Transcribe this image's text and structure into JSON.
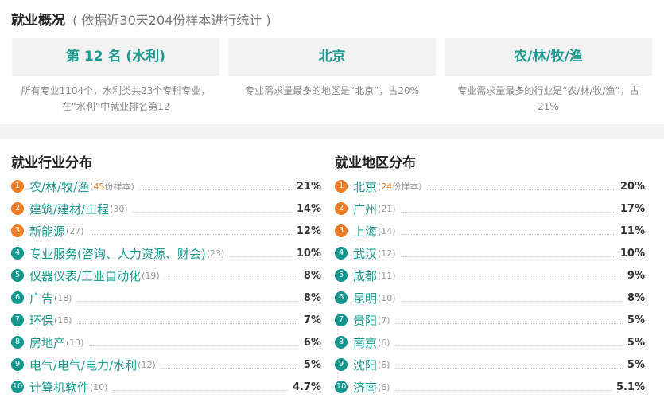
{
  "overview": {
    "title": "就业概况",
    "subtitle": "( 依据近30天204份样本进行统计 )",
    "cards": [
      {
        "label": "第 12 名 (水利)",
        "desc": "所有专业1104个，水利类共23个专科专业，在“水利”中就业排名第12"
      },
      {
        "label": "北京",
        "desc": "专业需求量最多的地区是“北京”，占20%"
      },
      {
        "label": "农/林/牧/渔",
        "desc": "专业需求量最多的行业是“农/林/牧/渔”，占21%"
      }
    ]
  },
  "industry": {
    "title": "就业行业分布",
    "items": [
      {
        "rank": "1",
        "name": "农/林/牧/渔",
        "count_pre": "(",
        "count_num": "45",
        "count_post": "份样本)",
        "pct": "21%"
      },
      {
        "rank": "2",
        "name": "建筑/建材/工程",
        "count_pre": "(30)",
        "count_num": "",
        "count_post": "",
        "pct": "14%"
      },
      {
        "rank": "3",
        "name": "新能源",
        "count_pre": "(27)",
        "count_num": "",
        "count_post": "",
        "pct": "12%"
      },
      {
        "rank": "4",
        "name": "专业服务(咨询、人力资源、财会)",
        "count_pre": "(23)",
        "count_num": "",
        "count_post": "",
        "pct": "10%"
      },
      {
        "rank": "5",
        "name": "仪器仪表/工业自动化",
        "count_pre": "(19)",
        "count_num": "",
        "count_post": "",
        "pct": "8%"
      },
      {
        "rank": "6",
        "name": "广告",
        "count_pre": "(18)",
        "count_num": "",
        "count_post": "",
        "pct": "8%"
      },
      {
        "rank": "7",
        "name": "环保",
        "count_pre": "(16)",
        "count_num": "",
        "count_post": "",
        "pct": "7%"
      },
      {
        "rank": "8",
        "name": "房地产",
        "count_pre": "(13)",
        "count_num": "",
        "count_post": "",
        "pct": "6%"
      },
      {
        "rank": "9",
        "name": "电气/电气/电力/水利",
        "count_pre": "(12)",
        "count_num": "",
        "count_post": "",
        "pct": "5%"
      },
      {
        "rank": "10",
        "name": "计算机软件",
        "count_pre": "(10)",
        "count_num": "",
        "count_post": "",
        "pct": "4.7%"
      }
    ]
  },
  "region": {
    "title": "就业地区分布",
    "items": [
      {
        "rank": "1",
        "name": "北京",
        "count_pre": "(",
        "count_num": "24",
        "count_post": "份样本)",
        "pct": "20%"
      },
      {
        "rank": "2",
        "name": "广州",
        "count_pre": "(21)",
        "count_num": "",
        "count_post": "",
        "pct": "17%"
      },
      {
        "rank": "3",
        "name": "上海",
        "count_pre": "(14)",
        "count_num": "",
        "count_post": "",
        "pct": "11%"
      },
      {
        "rank": "4",
        "name": "武汉",
        "count_pre": "(12)",
        "count_num": "",
        "count_post": "",
        "pct": "10%"
      },
      {
        "rank": "5",
        "name": "成都",
        "count_pre": "(11)",
        "count_num": "",
        "count_post": "",
        "pct": "9%"
      },
      {
        "rank": "6",
        "name": "昆明",
        "count_pre": "(10)",
        "count_num": "",
        "count_post": "",
        "pct": "8%"
      },
      {
        "rank": "7",
        "name": "贵阳",
        "count_pre": "(7)",
        "count_num": "",
        "count_post": "",
        "pct": "5%"
      },
      {
        "rank": "8",
        "name": "南京",
        "count_pre": "(6)",
        "count_num": "",
        "count_post": "",
        "pct": "5%"
      },
      {
        "rank": "9",
        "name": "沈阳",
        "count_pre": "(6)",
        "count_num": "",
        "count_post": "",
        "pct": "5%"
      },
      {
        "rank": "10",
        "name": "济南",
        "count_pre": "(6)",
        "count_num": "",
        "count_post": "",
        "pct": "5.1%"
      }
    ]
  },
  "colors": {
    "accent_teal": "#1b9a91",
    "rank_orange": "#f07c24",
    "rank_teal": "#12968d",
    "card_bg": "#f2f2f2"
  }
}
